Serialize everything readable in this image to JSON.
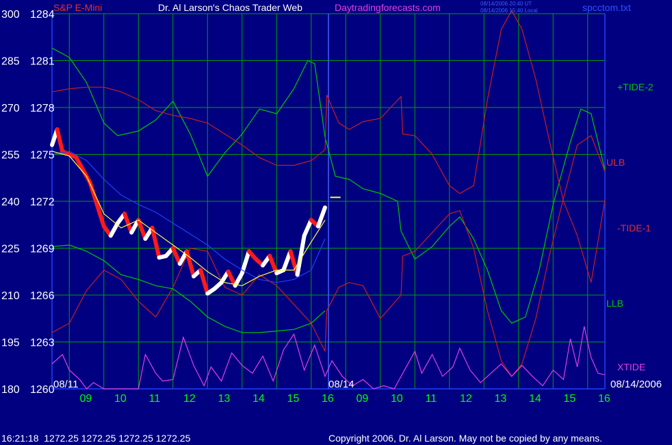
{
  "header": {
    "instrument": "S&P E-Mini",
    "author": "Dr. Al Larson's Chaos Trader Web",
    "site": "Daytradingforecasts.com",
    "timestamp_ut": "08/14/2006 20:40 UT",
    "timestamp_local": "08/14/2006 15:40 Local",
    "filename": "spcctom.txt"
  },
  "footer": {
    "quote": "16:21:18  1272.25 1272.25 1272.25 1272.25",
    "copyright": "Copyright 2006, Dr. Al Larson. May not be copied by any means."
  },
  "colors": {
    "background": "#000080",
    "grid": "#00a000",
    "tide": "#00c800",
    "band": "#c81e1e",
    "xtide": "#e040e0",
    "price": "#ffffff",
    "price_down": "#ff1a1a",
    "ma_yellow": "#ffff40",
    "ma_blue": "#2040ff",
    "hour_labels": "#00ff00",
    "axis_labels": "#ffffff"
  },
  "chart_data": {
    "type": "line",
    "left_axis_labels": [
      "300",
      "285",
      "270",
      "255",
      "240",
      "225",
      "210",
      "195",
      "180"
    ],
    "price_axis_labels": [
      "1284",
      "1281",
      "1278",
      "1275",
      "1272",
      "1269",
      "1266",
      "1263",
      "1260"
    ],
    "ylim_index": [
      180,
      300
    ],
    "ylim_price": [
      1260,
      1284
    ],
    "x_hour_labels": [
      "09",
      "10",
      "11",
      "12",
      "13",
      "14",
      "15",
      "16",
      "09",
      "10",
      "11",
      "12",
      "13",
      "14",
      "15",
      "16"
    ],
    "x_range_hours": [
      0,
      16
    ],
    "date_labels": {
      "start": "08/11",
      "mid": "08/14",
      "end": "08/14/2006"
    },
    "marker_price": 1272.25,
    "series": [
      {
        "name": "+TIDE-2",
        "kind": "tide",
        "x": [
          0,
          0.5,
          1,
          1.5,
          1.9,
          2.5,
          3,
          3.5,
          4,
          4.5,
          5,
          5.5,
          6,
          6.5,
          7,
          7.4,
          7.6,
          7.9,
          8.2,
          8.6,
          9,
          9.5,
          10,
          10.1,
          10.5,
          11,
          11.5,
          11.8,
          12.2,
          12.6,
          13,
          13.3,
          13.7,
          14.1,
          14.5,
          15,
          15.3,
          15.6,
          16
        ],
        "y": [
          1281.8,
          1281.2,
          1279.6,
          1277.0,
          1276.2,
          1276.5,
          1277.2,
          1278.4,
          1276.3,
          1273.6,
          1275.1,
          1276.3,
          1277.9,
          1277.6,
          1279.2,
          1281.0,
          1280.8,
          1276.1,
          1273.6,
          1273.4,
          1272.8,
          1272.5,
          1272.0,
          1270.1,
          1268.3,
          1269.1,
          1270.4,
          1271.0,
          1269.6,
          1267.6,
          1265.0,
          1264.2,
          1264.6,
          1267.6,
          1271.8,
          1275.8,
          1277.9,
          1277.6,
          1274.0
        ]
      },
      {
        "name": "ULB",
        "kind": "band",
        "x": [
          0,
          0.5,
          1,
          1.5,
          2,
          2.5,
          3,
          3.5,
          4,
          4.5,
          5,
          5.5,
          6,
          6.5,
          7,
          7.5,
          7.9,
          7.95,
          8.3,
          8.6,
          9,
          9.5,
          10.1,
          10.15,
          10.5,
          11,
          11.5,
          11.8,
          12.2,
          12.6,
          13,
          13.3,
          13.6,
          14,
          14.4,
          14.8,
          15.2,
          15.6,
          16
        ],
        "y": [
          1279.0,
          1279.2,
          1279.3,
          1279.3,
          1279.0,
          1278.5,
          1277.8,
          1277.5,
          1277.3,
          1277.0,
          1276.3,
          1275.6,
          1274.8,
          1274.3,
          1274.3,
          1274.6,
          1275.3,
          1278.8,
          1277.0,
          1276.6,
          1277.1,
          1277.3,
          1278.7,
          1276.3,
          1276.2,
          1275.0,
          1273.0,
          1272.5,
          1273.0,
          1278.5,
          1283.0,
          1284.2,
          1283.0,
          1279.8,
          1275.8,
          1272.0,
          1269.8,
          1266.8,
          1272.1
        ]
      },
      {
        "name": "LLB",
        "kind": "band",
        "x": [
          0,
          0.5,
          1,
          1.5,
          2,
          2.5,
          3,
          3.5,
          4,
          4.5,
          5,
          5.5,
          6,
          6.5,
          7,
          7.5,
          7.9,
          7.95,
          8.3,
          8.6,
          9,
          9.5,
          10.1,
          10.15,
          10.5,
          11,
          11.5,
          11.8,
          12.2,
          12.6,
          13,
          13.3,
          13.6,
          14,
          14.4,
          14.8,
          15.2,
          15.6,
          16
        ],
        "y": [
          1263.6,
          1264.2,
          1266.3,
          1267.6,
          1267.0,
          1265.6,
          1264.6,
          1266.5,
          1269.0,
          1268.8,
          1266.5,
          1266.0,
          1267.3,
          1266.6,
          1265.4,
          1264.2,
          1262.4,
          1265.0,
          1266.5,
          1266.8,
          1266.6,
          1264.5,
          1266.0,
          1268.5,
          1268.8,
          1270.0,
          1271.2,
          1271.4,
          1269.0,
          1265.0,
          1261.8,
          1260.8,
          1261.6,
          1264.5,
          1268.6,
          1272.2,
          1275.6,
          1276.2,
          1273.9
        ]
      },
      {
        "name": "-TIDE-1",
        "kind": "tide",
        "x": [
          0,
          0.5,
          1,
          1.5,
          2,
          2.5,
          3,
          3.5,
          4,
          4.5,
          5,
          5.5,
          6,
          6.5,
          7,
          7.5,
          7.9
        ],
        "y": [
          1269.1,
          1269.2,
          1268.8,
          1268.2,
          1267.3,
          1267.0,
          1266.6,
          1266.4,
          1265.6,
          1264.6,
          1264.0,
          1263.6,
          1263.6,
          1263.7,
          1263.8,
          1264.2,
          1265.0
        ]
      },
      {
        "name": "XTIDE",
        "kind": "xtide",
        "x": [
          0,
          0.3,
          0.5,
          0.8,
          1,
          1.2,
          1.5,
          1.9,
          2.2,
          2.5,
          2.7,
          3,
          3.2,
          3.5,
          3.8,
          4.1,
          4.4,
          4.6,
          4.9,
          5.2,
          5.5,
          5.8,
          6.1,
          6.4,
          6.7,
          7,
          7.3,
          7.6,
          7.9,
          8.1,
          8.4,
          8.7,
          9,
          9.3,
          9.6,
          9.9,
          10.2,
          10.5,
          10.7,
          11,
          11.3,
          11.6,
          11.8,
          12.1,
          12.4,
          12.7,
          13,
          13.3,
          13.6,
          13.9,
          14.2,
          14.5,
          14.8,
          15.0,
          15.2,
          15.4,
          15.6,
          15.8,
          16
        ],
        "y": [
          1261.6,
          1262.2,
          1261.2,
          1260.6,
          1260.0,
          1260.4,
          1260.0,
          1260.0,
          1260.0,
          1260.0,
          1262.2,
          1261.0,
          1260.5,
          1260.6,
          1263.3,
          1261.5,
          1260.2,
          1261.4,
          1260.5,
          1262.3,
          1261.5,
          1261.0,
          1262.1,
          1260.5,
          1262.5,
          1263.5,
          1261.2,
          1262.8,
          1260.8,
          1261.8,
          1260.8,
          1260.2,
          1260.6,
          1260.0,
          1260.2,
          1260.0,
          1261.2,
          1262.4,
          1261.0,
          1262.2,
          1260.8,
          1261.4,
          1262.6,
          1261.2,
          1260.4,
          1261.0,
          1261.6,
          1260.8,
          1261.5,
          1260.8,
          1260.2,
          1261.2,
          1260.6,
          1263.2,
          1261.4,
          1264.0,
          1262.0,
          1261.0,
          1260.9
        ]
      }
    ],
    "price_series": {
      "name": "S&P E-Mini",
      "x": [
        0,
        0.15,
        0.3,
        0.5,
        0.7,
        0.9,
        1.1,
        1.3,
        1.5,
        1.7,
        1.9,
        2.1,
        2.3,
        2.5,
        2.7,
        2.9,
        3.1,
        3.3,
        3.5,
        3.7,
        3.9,
        4.1,
        4.3,
        4.5,
        4.7,
        4.9,
        5.1,
        5.3,
        5.5,
        5.7,
        5.9,
        6.1,
        6.3,
        6.5,
        6.7,
        6.9,
        7.1,
        7.3,
        7.5,
        7.7,
        7.9
      ],
      "y": [
        1275.6,
        1276.6,
        1275.2,
        1275.0,
        1274.8,
        1274.0,
        1273.2,
        1271.8,
        1270.4,
        1269.8,
        1270.6,
        1271.2,
        1270.0,
        1270.8,
        1269.6,
        1270.3,
        1268.4,
        1268.5,
        1269.0,
        1268.0,
        1268.8,
        1267.2,
        1267.6,
        1266.1,
        1266.4,
        1266.8,
        1267.5,
        1266.6,
        1267.4,
        1268.8,
        1268.3,
        1267.9,
        1268.5,
        1267.4,
        1267.6,
        1268.8,
        1267.3,
        1269.8,
        1270.8,
        1270.4,
        1271.6
      ]
    },
    "ma_series": {
      "name": "moving average",
      "x": [
        0,
        0.5,
        1,
        1.5,
        2,
        2.5,
        3,
        3.5,
        4,
        4.5,
        5,
        5.5,
        6,
        6.5,
        7,
        7.5,
        7.9
      ],
      "y": [
        1275.2,
        1274.9,
        1273.6,
        1271.2,
        1270.3,
        1270.8,
        1270.0,
        1269.2,
        1268.4,
        1267.5,
        1266.8,
        1266.6,
        1267.2,
        1267.6,
        1267.6,
        1269.4,
        1270.8
      ]
    },
    "ma2_series": {
      "name": "moving average 2",
      "x": [
        0,
        0.5,
        1,
        1.5,
        2,
        2.5,
        3,
        3.5,
        4,
        4.5,
        5,
        5.5,
        6,
        6.5,
        7,
        7.5,
        7.9
      ],
      "y": [
        1275.0,
        1275.2,
        1274.6,
        1273.4,
        1272.4,
        1271.8,
        1271.3,
        1270.6,
        1269.9,
        1269.2,
        1268.3,
        1267.6,
        1267.0,
        1266.8,
        1267.0,
        1267.6,
        1269.6
      ]
    }
  }
}
